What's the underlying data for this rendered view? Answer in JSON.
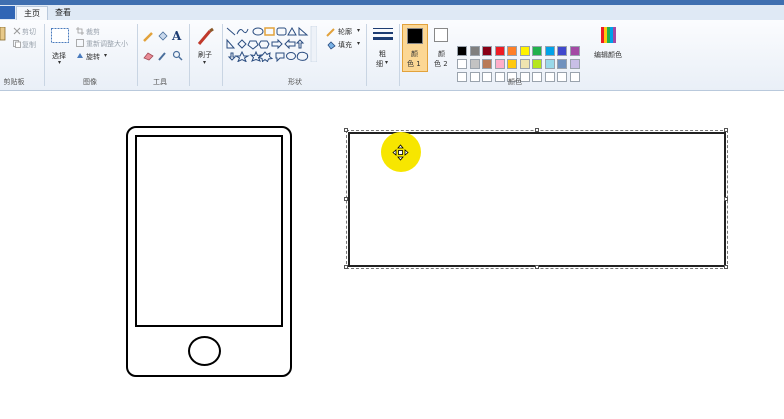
{
  "tabs": {
    "home": "主页",
    "view": "查看"
  },
  "clipboard": {
    "cut": "剪切",
    "copy": "复制",
    "label": "剪贴板"
  },
  "image": {
    "select": "选择",
    "crop": "裁剪",
    "resize": "重新调整大小",
    "rotate": "旋转",
    "label": "图像"
  },
  "tools": {
    "label": "工具",
    "text_tool": "A"
  },
  "brushes": {
    "label": "刷子"
  },
  "shapes": {
    "outline": "轮廓",
    "fill": "填充",
    "label": "形状"
  },
  "size": {
    "label_1": "粗",
    "label_2": "细"
  },
  "color1": {
    "line1": "颜",
    "line2": "色 1"
  },
  "color2": {
    "line1": "颜",
    "line2": "色 2"
  },
  "colors": {
    "label": "颜色",
    "edit": "编辑颜色",
    "row1": [
      "#000000",
      "#7f7f7f",
      "#880015",
      "#ed1c24",
      "#ff7f27",
      "#fff200",
      "#22b14c",
      "#00a2e8",
      "#3f48cc",
      "#a349a4"
    ],
    "row2": [
      "#ffffff",
      "#c3c3c3",
      "#b97a57",
      "#ffaec9",
      "#ffc90e",
      "#efe4b0",
      "#b5e61d",
      "#99d9ea",
      "#7092be",
      "#c8bfe7"
    ],
    "row3": [
      "#ffffff",
      "#ffffff",
      "#ffffff",
      "#ffffff",
      "#ffffff",
      "#ffffff",
      "#ffffff",
      "#ffffff",
      "#ffffff",
      "#ffffff"
    ]
  },
  "accent": {
    "active_color_button": "#fcd794",
    "cursor_highlight": "#f7e600"
  }
}
